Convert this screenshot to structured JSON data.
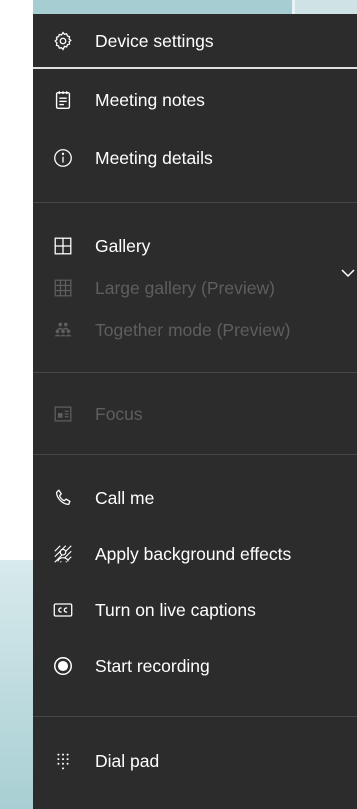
{
  "menu": {
    "device_settings": "Device settings",
    "meeting_notes": "Meeting notes",
    "meeting_details": "Meeting details",
    "gallery": "Gallery",
    "large_gallery": "Large gallery (Preview)",
    "together_mode": "Together mode (Preview)",
    "focus": "Focus",
    "call_me": "Call me",
    "apply_background": "Apply background effects",
    "live_captions": "Turn on live captions",
    "start_recording": "Start recording",
    "dial_pad": "Dial pad"
  },
  "icons": {
    "device_settings": "gear-icon",
    "meeting_notes": "notes-icon",
    "meeting_details": "info-icon",
    "gallery": "grid-2x2-icon",
    "large_gallery": "grid-3x3-icon",
    "together_mode": "people-group-icon",
    "focus": "focus-icon",
    "call_me": "phone-icon",
    "apply_background": "background-effects-icon",
    "live_captions": "cc-icon",
    "start_recording": "record-icon",
    "dial_pad": "dialpad-icon"
  },
  "colors": {
    "menu_bg": "#2c2c2c",
    "text": "#ffffff",
    "disabled_text": "#5e5e5e",
    "divider": "#474747",
    "backdrop": "#a6cdd1"
  }
}
